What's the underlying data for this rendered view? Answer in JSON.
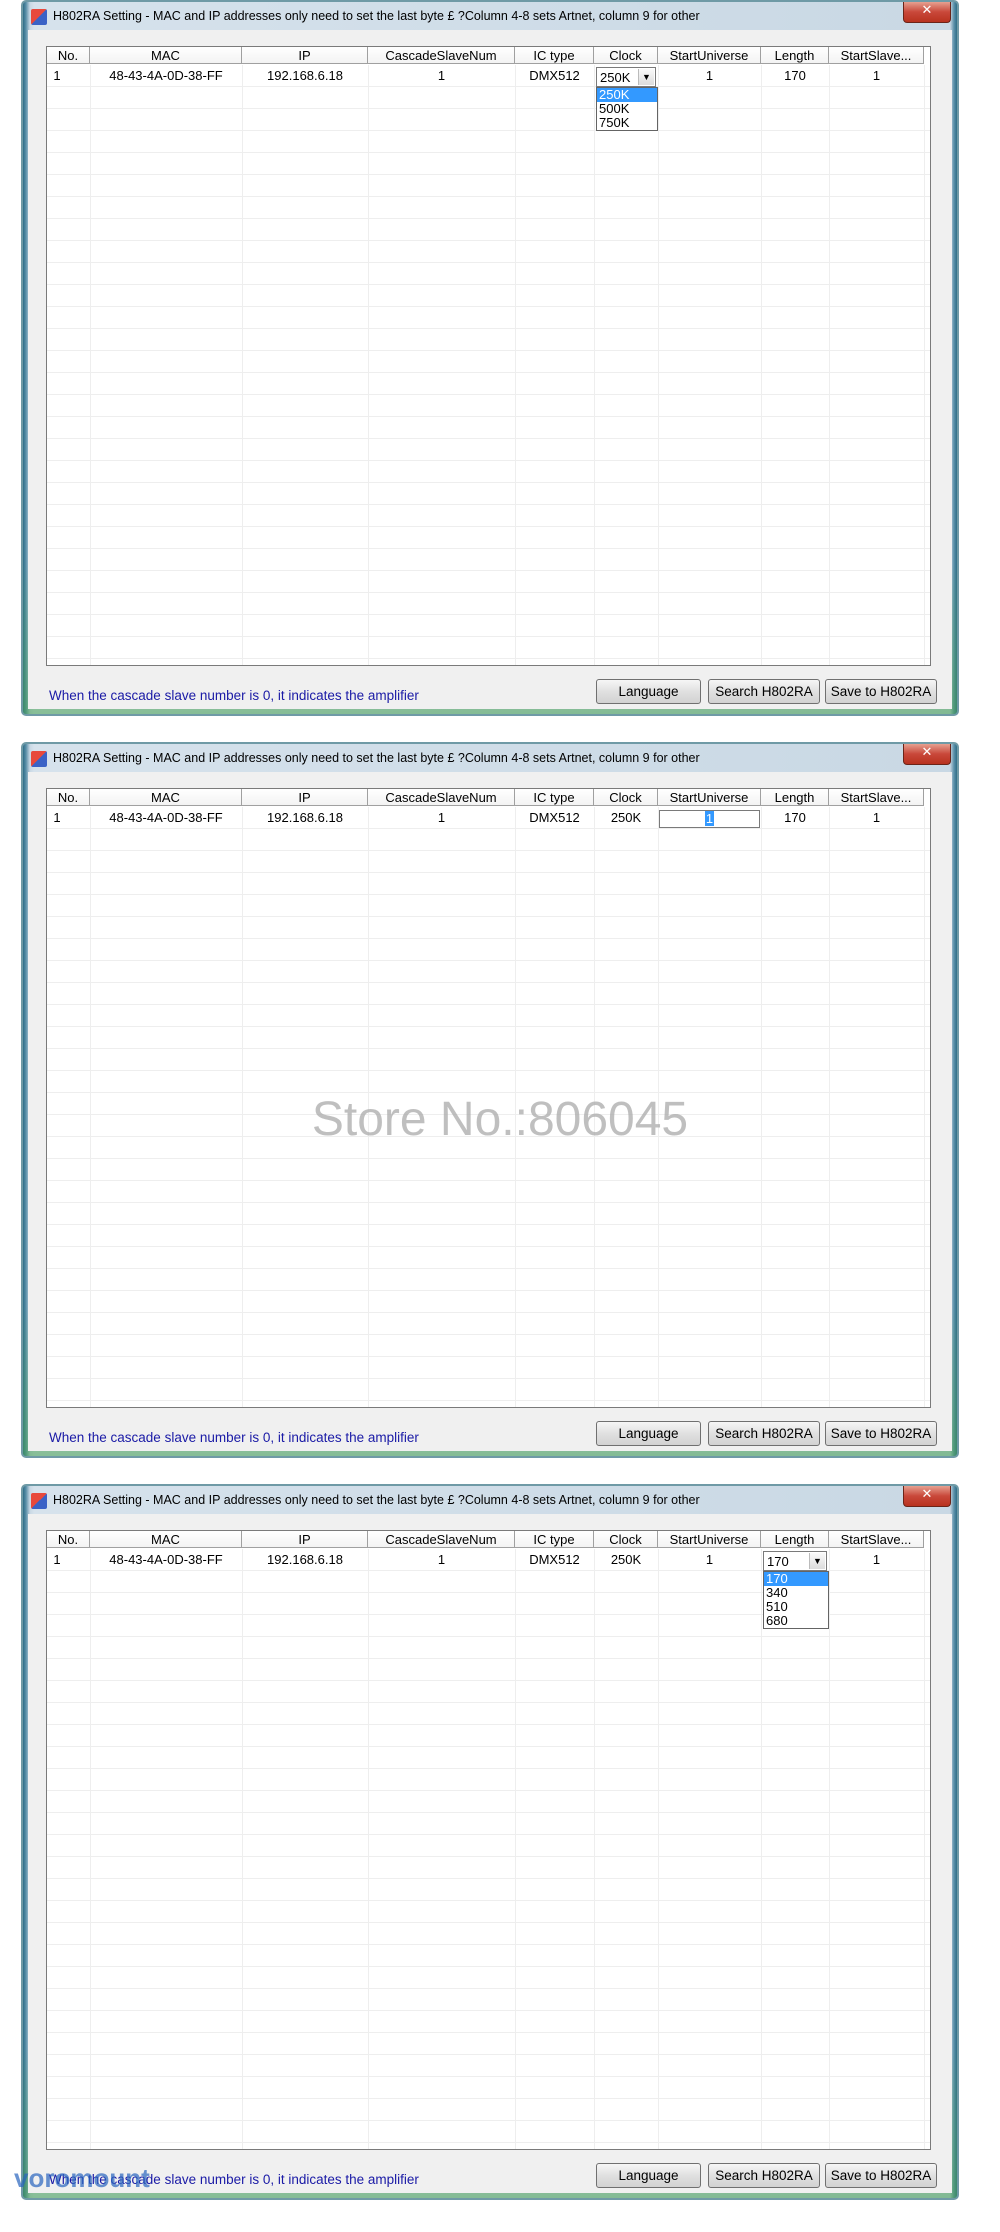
{
  "colors": {
    "selection": "#3399ff",
    "note_text": "#1a1aa6",
    "close_button": "#c9483a"
  },
  "icons": {
    "close": "close-icon",
    "app": "app-icon",
    "dropdown_arrow": "chevron-down-icon"
  },
  "windows": [
    {
      "title": "H802RA Setting - MAC and IP addresses only need to set the last byte £ ?Column 4-8 sets Artnet, column 9 for other",
      "close_label": "✕",
      "columns": [
        "No.",
        "MAC",
        "IP",
        "CascadeSlaveNum",
        "IC type",
        "Clock",
        "StartUniverse",
        "Length",
        "StartSlave..."
      ],
      "row": {
        "no": "1",
        "mac": "48-43-4A-0D-38-FF",
        "ip": "192.168.6.18",
        "cascade": "1",
        "ic_type": "DMX512",
        "clock": "250K",
        "start_universe": "1",
        "length": "170",
        "start_slave": "1"
      },
      "active_combo": {
        "value": "250K",
        "options": [
          "250K",
          "500K",
          "750K"
        ],
        "selected": "250K"
      },
      "note": "When the cascade slave number is 0, it indicates the amplifier",
      "buttons": {
        "language": "Language",
        "search": "Search H802RA",
        "save": "Save to H802RA"
      }
    },
    {
      "title": "H802RA Setting - MAC and IP addresses only need to set the last byte £ ?Column 4-8 sets Artnet, column 9 for other",
      "close_label": "✕",
      "columns": [
        "No.",
        "MAC",
        "IP",
        "CascadeSlaveNum",
        "IC type",
        "Clock",
        "StartUniverse",
        "Length",
        "StartSlave..."
      ],
      "row": {
        "no": "1",
        "mac": "48-43-4A-0D-38-FF",
        "ip": "192.168.6.18",
        "cascade": "1",
        "ic_type": "DMX512",
        "clock": "250K",
        "start_universe": "1",
        "length": "170",
        "start_slave": "1"
      },
      "active_edit": {
        "value": "1"
      },
      "note": "When the cascade slave number is 0, it indicates the amplifier",
      "buttons": {
        "language": "Language",
        "search": "Search H802RA",
        "save": "Save to H802RA"
      }
    },
    {
      "title": "H802RA Setting - MAC and IP addresses only need to set the last byte £ ?Column 4-8 sets Artnet, column 9 for other",
      "close_label": "✕",
      "columns": [
        "No.",
        "MAC",
        "IP",
        "CascadeSlaveNum",
        "IC type",
        "Clock",
        "StartUniverse",
        "Length",
        "StartSlave..."
      ],
      "row": {
        "no": "1",
        "mac": "48-43-4A-0D-38-FF",
        "ip": "192.168.6.18",
        "cascade": "1",
        "ic_type": "DMX512",
        "clock": "250K",
        "start_universe": "1",
        "length": "170",
        "start_slave": "1"
      },
      "active_combo": {
        "value": "170",
        "options": [
          "170",
          "340",
          "510",
          "680"
        ],
        "selected": "170"
      },
      "note": "When the cascade slave number is 0, it indicates the amplifier",
      "buttons": {
        "language": "Language",
        "search": "Search H802RA",
        "save": "Save to H802RA"
      }
    }
  ],
  "watermark": "Store No.:806045",
  "brand_watermark": "voromount"
}
